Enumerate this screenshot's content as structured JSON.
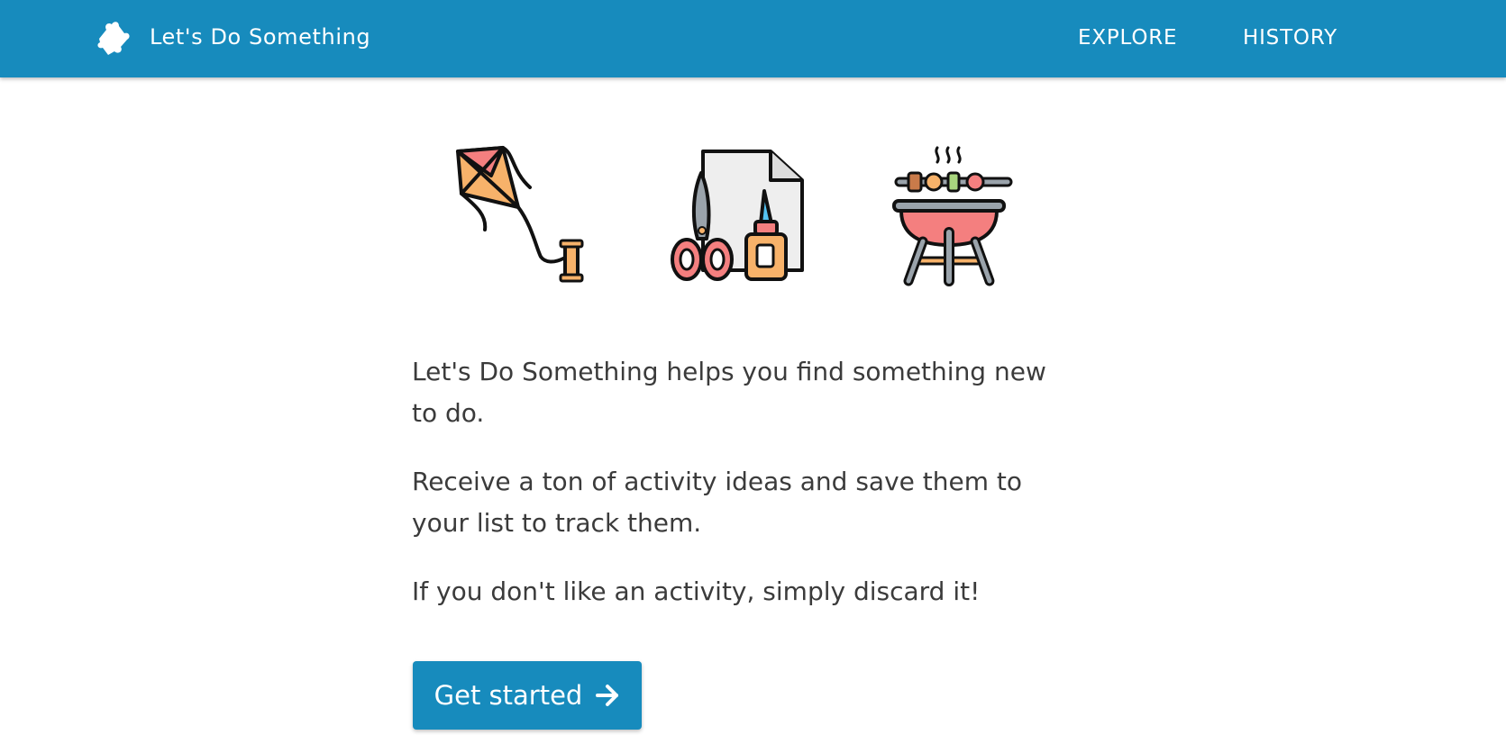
{
  "header": {
    "brand_icon": "puzzle-piece-icon",
    "brand_title": "Let's Do Something",
    "nav": {
      "explore_label": "EXPLORE",
      "history_label": "HISTORY"
    },
    "background_color": "#178bbd"
  },
  "hero": {
    "illustrations": [
      "kite-icon",
      "scissors-glue-craft-icon",
      "barbecue-grill-icon"
    ]
  },
  "main": {
    "paragraphs": {
      "intro": "Let's Do Something helps you find something new to do.",
      "ideas": "Receive a ton of activity ideas and save them to your list to track them.",
      "discard": "If you don't like an activity, simply discard it!"
    },
    "cta": {
      "label": "Get started",
      "icon": "arrow-right-icon",
      "color": "#178bbd"
    }
  }
}
